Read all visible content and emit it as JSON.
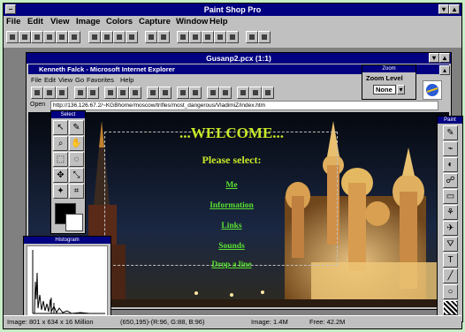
{
  "app": {
    "title": "Paint Shop Pro",
    "menu": [
      "File",
      "Edit",
      "View",
      "Image",
      "Colors",
      "Capture",
      "Window",
      "Help"
    ]
  },
  "image_window": {
    "title": "Gusanp2.pcx (1:1)"
  },
  "browser": {
    "title": "Kenneth Falck - Microsoft Internet Explorer",
    "menu": [
      "File",
      "Edit",
      "View",
      "Go",
      "Favorites",
      "Help"
    ],
    "address_label": "Open",
    "address": "http://136.126.67.2/~KGBhome/moscow/trifles/most_dangerous/VladimiZ/index.htm"
  },
  "zoom_palette": {
    "title": "Zoom",
    "label": "Zoom Level",
    "value": "None"
  },
  "select_palette": {
    "title": "Select"
  },
  "histogram": {
    "title": "Histogram"
  },
  "paint_palette": {
    "title": "Paint"
  },
  "webpage": {
    "heading": "...WELCOME...",
    "subheading": "Please select:",
    "links": [
      "Me",
      "Information",
      "Links",
      "Sounds",
      "Drop a line"
    ]
  },
  "status": {
    "dimensions": "Image: 801 x 634 x 16 Million",
    "pixel": "(650,195)-(R:96, G:88, B:96)",
    "image_mem": "Image: 1.4M",
    "free_mem": "Free: 42.2M"
  },
  "colors": {
    "titlebar": "#000080",
    "face": "#c0c0c0",
    "welcome_text": "#c8e828",
    "link_text": "#58e030"
  }
}
